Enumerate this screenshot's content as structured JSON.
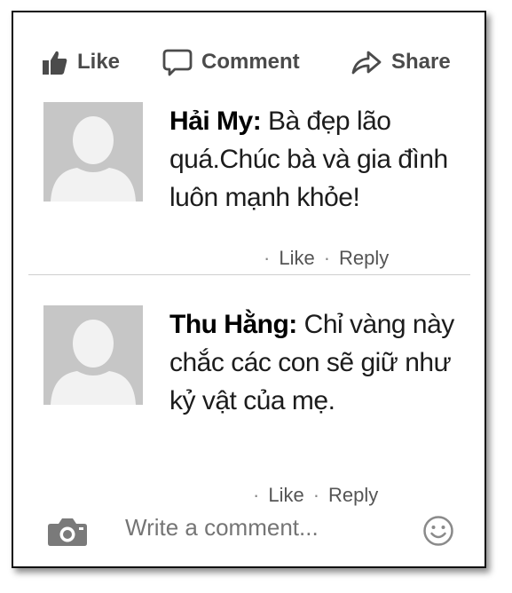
{
  "actions": {
    "like_label": "Like",
    "comment_label": "Comment",
    "share_label": "Share"
  },
  "comments": [
    {
      "name": "Hải My:",
      "text": "Bà đẹp lão quá.Chúc bà và gia đình luôn mạnh khỏe!",
      "like_label": "Like",
      "reply_label": "Reply"
    },
    {
      "name": "Thu Hằng:",
      "text": "Chỉ vàng này chắc các con sẽ giữ như kỷ vật của mẹ.",
      "like_label": "Like",
      "reply_label": "Reply"
    }
  ],
  "composer": {
    "placeholder": "Write a comment..."
  },
  "icons": {
    "like": "thumbs-up-icon",
    "comment": "speech-bubble-icon",
    "share": "share-arrow-icon",
    "camera": "camera-icon",
    "emoji": "smiley-icon"
  },
  "colors": {
    "text": "#1c1c1c",
    "meta": "#555555",
    "avatar": "#c6c6c6"
  }
}
